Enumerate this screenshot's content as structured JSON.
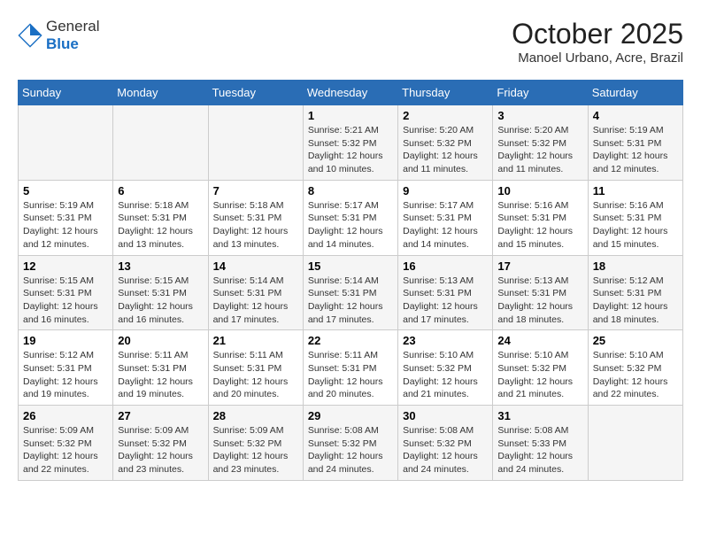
{
  "header": {
    "logo_line1": "General",
    "logo_line2": "Blue",
    "month": "October 2025",
    "location": "Manoel Urbano, Acre, Brazil"
  },
  "weekdays": [
    "Sunday",
    "Monday",
    "Tuesday",
    "Wednesday",
    "Thursday",
    "Friday",
    "Saturday"
  ],
  "weeks": [
    [
      {
        "day": "",
        "info": ""
      },
      {
        "day": "",
        "info": ""
      },
      {
        "day": "",
        "info": ""
      },
      {
        "day": "1",
        "info": "Sunrise: 5:21 AM\nSunset: 5:32 PM\nDaylight: 12 hours\nand 10 minutes."
      },
      {
        "day": "2",
        "info": "Sunrise: 5:20 AM\nSunset: 5:32 PM\nDaylight: 12 hours\nand 11 minutes."
      },
      {
        "day": "3",
        "info": "Sunrise: 5:20 AM\nSunset: 5:32 PM\nDaylight: 12 hours\nand 11 minutes."
      },
      {
        "day": "4",
        "info": "Sunrise: 5:19 AM\nSunset: 5:31 PM\nDaylight: 12 hours\nand 12 minutes."
      }
    ],
    [
      {
        "day": "5",
        "info": "Sunrise: 5:19 AM\nSunset: 5:31 PM\nDaylight: 12 hours\nand 12 minutes."
      },
      {
        "day": "6",
        "info": "Sunrise: 5:18 AM\nSunset: 5:31 PM\nDaylight: 12 hours\nand 13 minutes."
      },
      {
        "day": "7",
        "info": "Sunrise: 5:18 AM\nSunset: 5:31 PM\nDaylight: 12 hours\nand 13 minutes."
      },
      {
        "day": "8",
        "info": "Sunrise: 5:17 AM\nSunset: 5:31 PM\nDaylight: 12 hours\nand 14 minutes."
      },
      {
        "day": "9",
        "info": "Sunrise: 5:17 AM\nSunset: 5:31 PM\nDaylight: 12 hours\nand 14 minutes."
      },
      {
        "day": "10",
        "info": "Sunrise: 5:16 AM\nSunset: 5:31 PM\nDaylight: 12 hours\nand 15 minutes."
      },
      {
        "day": "11",
        "info": "Sunrise: 5:16 AM\nSunset: 5:31 PM\nDaylight: 12 hours\nand 15 minutes."
      }
    ],
    [
      {
        "day": "12",
        "info": "Sunrise: 5:15 AM\nSunset: 5:31 PM\nDaylight: 12 hours\nand 16 minutes."
      },
      {
        "day": "13",
        "info": "Sunrise: 5:15 AM\nSunset: 5:31 PM\nDaylight: 12 hours\nand 16 minutes."
      },
      {
        "day": "14",
        "info": "Sunrise: 5:14 AM\nSunset: 5:31 PM\nDaylight: 12 hours\nand 17 minutes."
      },
      {
        "day": "15",
        "info": "Sunrise: 5:14 AM\nSunset: 5:31 PM\nDaylight: 12 hours\nand 17 minutes."
      },
      {
        "day": "16",
        "info": "Sunrise: 5:13 AM\nSunset: 5:31 PM\nDaylight: 12 hours\nand 17 minutes."
      },
      {
        "day": "17",
        "info": "Sunrise: 5:13 AM\nSunset: 5:31 PM\nDaylight: 12 hours\nand 18 minutes."
      },
      {
        "day": "18",
        "info": "Sunrise: 5:12 AM\nSunset: 5:31 PM\nDaylight: 12 hours\nand 18 minutes."
      }
    ],
    [
      {
        "day": "19",
        "info": "Sunrise: 5:12 AM\nSunset: 5:31 PM\nDaylight: 12 hours\nand 19 minutes."
      },
      {
        "day": "20",
        "info": "Sunrise: 5:11 AM\nSunset: 5:31 PM\nDaylight: 12 hours\nand 19 minutes."
      },
      {
        "day": "21",
        "info": "Sunrise: 5:11 AM\nSunset: 5:31 PM\nDaylight: 12 hours\nand 20 minutes."
      },
      {
        "day": "22",
        "info": "Sunrise: 5:11 AM\nSunset: 5:31 PM\nDaylight: 12 hours\nand 20 minutes."
      },
      {
        "day": "23",
        "info": "Sunrise: 5:10 AM\nSunset: 5:32 PM\nDaylight: 12 hours\nand 21 minutes."
      },
      {
        "day": "24",
        "info": "Sunrise: 5:10 AM\nSunset: 5:32 PM\nDaylight: 12 hours\nand 21 minutes."
      },
      {
        "day": "25",
        "info": "Sunrise: 5:10 AM\nSunset: 5:32 PM\nDaylight: 12 hours\nand 22 minutes."
      }
    ],
    [
      {
        "day": "26",
        "info": "Sunrise: 5:09 AM\nSunset: 5:32 PM\nDaylight: 12 hours\nand 22 minutes."
      },
      {
        "day": "27",
        "info": "Sunrise: 5:09 AM\nSunset: 5:32 PM\nDaylight: 12 hours\nand 23 minutes."
      },
      {
        "day": "28",
        "info": "Sunrise: 5:09 AM\nSunset: 5:32 PM\nDaylight: 12 hours\nand 23 minutes."
      },
      {
        "day": "29",
        "info": "Sunrise: 5:08 AM\nSunset: 5:32 PM\nDaylight: 12 hours\nand 24 minutes."
      },
      {
        "day": "30",
        "info": "Sunrise: 5:08 AM\nSunset: 5:32 PM\nDaylight: 12 hours\nand 24 minutes."
      },
      {
        "day": "31",
        "info": "Sunrise: 5:08 AM\nSunset: 5:33 PM\nDaylight: 12 hours\nand 24 minutes."
      },
      {
        "day": "",
        "info": ""
      }
    ]
  ]
}
